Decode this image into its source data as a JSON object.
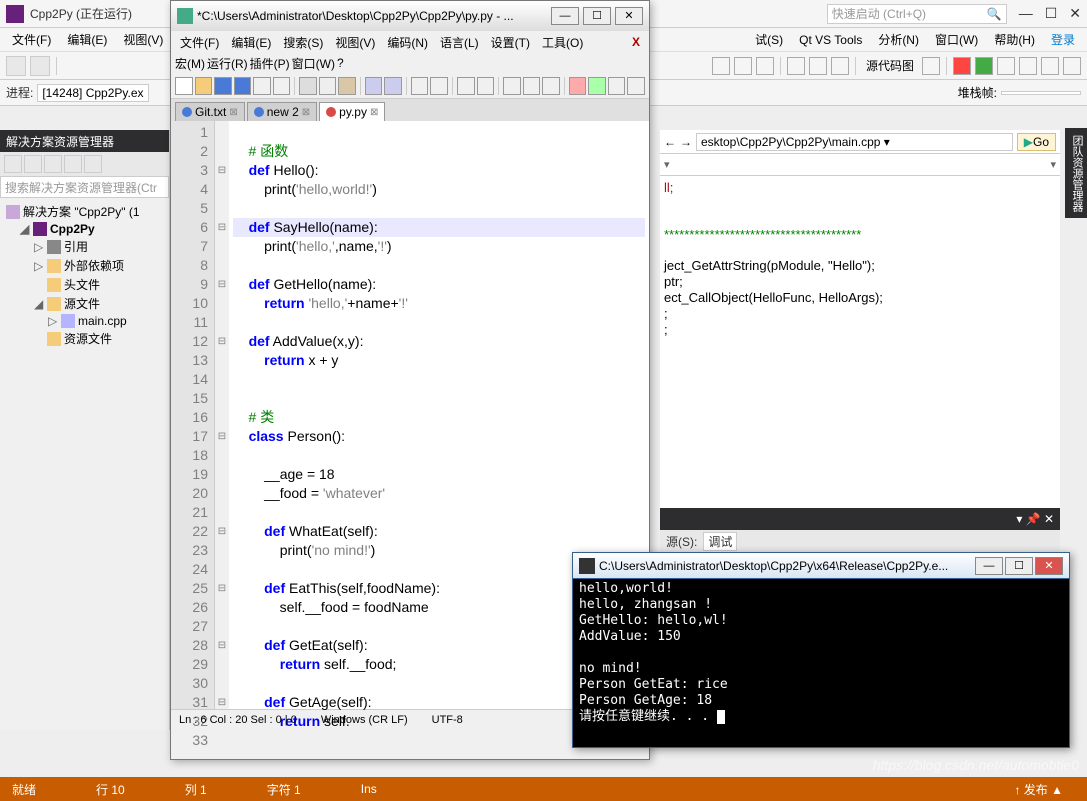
{
  "vs": {
    "title": "Cpp2Py (正在运行)",
    "quick_placeholder": "快速启动 (Ctrl+Q)",
    "menu": [
      "文件(F)",
      "编辑(E)",
      "视图(V)",
      "",
      "",
      "",
      "",
      "",
      "",
      "试(S)",
      "Qt VS Tools",
      "分析(N)",
      "窗口(W)",
      "帮助(H)"
    ],
    "login": "登录",
    "toolbar_stack_lbl": "堆栈帧:",
    "toolbar_src_lbl": "源代码图",
    "process_label": "进程:",
    "process_value": "[14248] Cpp2Py.ex",
    "right_path": "esktop\\Cpp2Py\\Cpp2Py\\main.cpp",
    "go": "Go",
    "cpp_lines": [
      "ll;",
      "",
      "",
      "***************************************",
      "",
      "ject_GetAttrString(pModule, \"Hello\");",
      "ptr;",
      "ect_CallObject(HelloFunc, HelloArgs);",
      ";",
      ";"
    ],
    "bot_source_lbl": "源(S):",
    "bot_source_val": "调试",
    "status": {
      "ready": "就绪",
      "row": "行 10",
      "col": "列 1",
      "ch": "字符 1",
      "ins": "Ins",
      "pub": "↑ 发布 ▲"
    }
  },
  "solution": {
    "header": "解决方案资源管理器",
    "search_placeholder": "搜索解决方案资源管理器(Ctr",
    "sol_label": "解决方案 \"Cpp2Py\" (1",
    "proj": "Cpp2Py",
    "items": [
      "引用",
      "外部依赖项",
      "头文件",
      "源文件",
      "main.cpp",
      "资源文件"
    ]
  },
  "side_tab": "团队资源管理器",
  "npp": {
    "title": "*C:\\Users\\Administrator\\Desktop\\Cpp2Py\\Cpp2Py\\py.py - ...",
    "menu1": [
      "文件(F)",
      "编辑(E)",
      "搜索(S)",
      "视图(V)",
      "编码(N)",
      "语言(L)",
      "设置(T)",
      "工具(O)"
    ],
    "menu2": [
      "宏(M)",
      "运行(R)",
      "插件(P)",
      "窗口(W)",
      "?"
    ],
    "tabs": [
      {
        "label": "Git.txt",
        "active": false,
        "color": "blue"
      },
      {
        "label": "new 2",
        "active": false,
        "color": "blue"
      },
      {
        "label": "py.py",
        "active": true,
        "color": "red"
      }
    ],
    "code": [
      {
        "n": 1,
        "t": ""
      },
      {
        "n": 2,
        "t": "    # 函数",
        "cls": "comment"
      },
      {
        "n": 3,
        "t": "    def Hello():",
        "fold": "⊟"
      },
      {
        "n": 4,
        "t": "        print('hello,world!')"
      },
      {
        "n": 5,
        "t": ""
      },
      {
        "n": 6,
        "t": "    def SayHello(name):",
        "fold": "⊟",
        "hl": true
      },
      {
        "n": 7,
        "t": "        print('hello,',name,'!')"
      },
      {
        "n": 8,
        "t": ""
      },
      {
        "n": 9,
        "t": "    def GetHello(name):",
        "fold": "⊟"
      },
      {
        "n": 10,
        "t": "        return 'hello,'+name+'!'"
      },
      {
        "n": 11,
        "t": ""
      },
      {
        "n": 12,
        "t": "    def AddValue(x,y):",
        "fold": "⊟"
      },
      {
        "n": 13,
        "t": "        return x + y"
      },
      {
        "n": 14,
        "t": ""
      },
      {
        "n": 15,
        "t": ""
      },
      {
        "n": 16,
        "t": "    # 类",
        "cls": "comment"
      },
      {
        "n": 17,
        "t": "    class Person():",
        "fold": "⊟"
      },
      {
        "n": 18,
        "t": ""
      },
      {
        "n": 19,
        "t": "        __age = 18"
      },
      {
        "n": 20,
        "t": "        __food = 'whatever'"
      },
      {
        "n": 21,
        "t": ""
      },
      {
        "n": 22,
        "t": "        def WhatEat(self):",
        "fold": "⊟"
      },
      {
        "n": 23,
        "t": "            print('no mind!')"
      },
      {
        "n": 24,
        "t": ""
      },
      {
        "n": 25,
        "t": "        def EatThis(self,foodName):",
        "fold": "⊟"
      },
      {
        "n": 26,
        "t": "            self.__food = foodName"
      },
      {
        "n": 27,
        "t": ""
      },
      {
        "n": 28,
        "t": "        def GetEat(self):",
        "fold": "⊟"
      },
      {
        "n": 29,
        "t": "            return self.__food;"
      },
      {
        "n": 30,
        "t": ""
      },
      {
        "n": 31,
        "t": "        def GetAge(self):",
        "fold": "⊟"
      },
      {
        "n": 32,
        "t": "            return self."
      },
      {
        "n": 33,
        "t": ""
      }
    ],
    "status": {
      "pos": "Ln : 6   Col : 20   Sel : 0 | 0",
      "eol": "Windows (CR LF)",
      "enc": "UTF-8"
    }
  },
  "console": {
    "title": "C:\\Users\\Administrator\\Desktop\\Cpp2Py\\x64\\Release\\Cpp2Py.e...",
    "lines": [
      "hello,world!",
      "hello, zhangsan !",
      "GetHello: hello,wl!",
      "AddValue: 150",
      "",
      "no mind!",
      "Person GetEat: rice",
      "Person GetAge: 18",
      "请按任意键继续. . . "
    ]
  },
  "watermark": "https://blog.csdn.net/automobtie0"
}
